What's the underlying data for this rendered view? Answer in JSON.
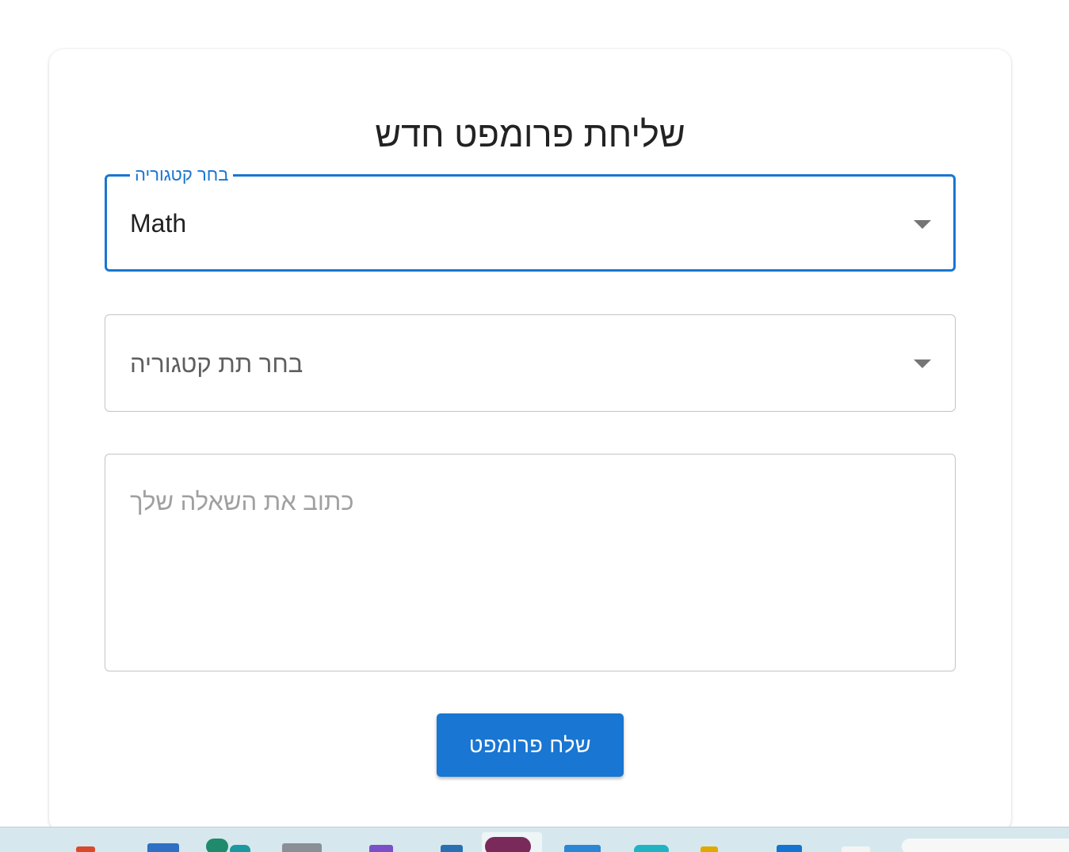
{
  "form": {
    "title": "שליחת פרומפט חדש",
    "category": {
      "label": "בחר קטגוריה",
      "selected_value": "Math"
    },
    "subcategory": {
      "placeholder": "בחר תת קטגוריה"
    },
    "question": {
      "placeholder": "כתוב את השאלה שלך"
    },
    "submit_label": "שלח פרומפט"
  },
  "colors": {
    "accent": "#1976d2",
    "border": "#c4c4c4",
    "taskbar": "#d6e8ee"
  },
  "icons": {
    "dropdown": "caret-down-icon"
  }
}
